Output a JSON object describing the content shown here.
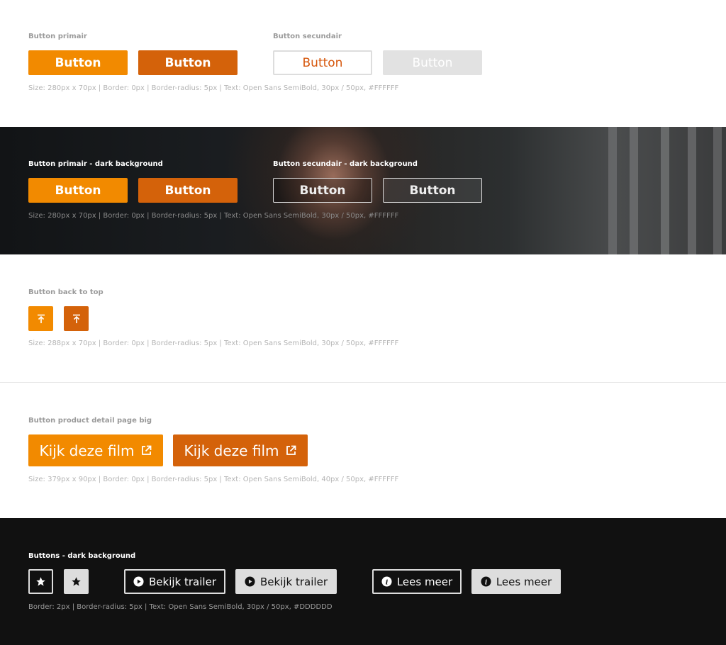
{
  "section_primary": {
    "title_primary": "Button primair",
    "title_secondary": "Button secundair",
    "btn_label": "Button",
    "spec": "Size: 280px x 70px   |   Border: 0px   |   Border-radius: 5px   |   Text: Open Sans SemiBold, 30px / 50px, #FFFFFF"
  },
  "section_dark": {
    "title_primary": "Button primair  - dark background",
    "title_secondary": "Button secundair  - dark background",
    "btn_label": "Button",
    "spec": "Size: 280px x 70px   |   Border: 0px   |   Border-radius: 5px   |   Text: Open Sans SemiBold, 30px / 50px, #FFFFFF"
  },
  "section_top": {
    "title": "Button back to top",
    "spec": "Size: 288px x 70px   |   Border: 0px   |   Border-radius: 5px   |   Text: Open Sans SemiBold, 30px / 50px, #FFFFFF"
  },
  "section_detail": {
    "title": "Button product detail page big",
    "btn_label": "Kijk deze film",
    "spec": "Size: 379px x 90px   |   Border: 0px   |   Border-radius: 5px   |   Text: Open Sans SemiBold, 40px / 50px, #FFFFFF"
  },
  "section_buttons_dark": {
    "title": "Buttons - dark background",
    "trailer_label": "Bekijk trailer",
    "more_label": "Lees meer",
    "spec": "Border: 2px   |   Border-radius: 5px   |   Text: Open Sans SemiBold, 30px / 50px, #DDDDDD"
  },
  "colors": {
    "orange": "#f28a00",
    "orange_dark": "#d4620a",
    "outline_text": "#d6570c",
    "grey": "#e2e2e2",
    "light_border": "#dddddd"
  }
}
